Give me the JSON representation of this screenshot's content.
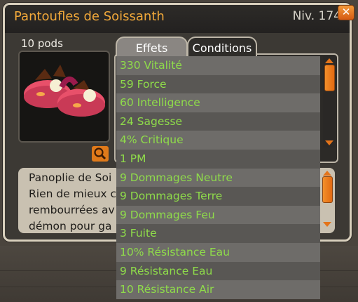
{
  "window": {
    "title": "Pantoufles de Soissanth",
    "level": "Niv. 174",
    "close_icon": "close-icon"
  },
  "item": {
    "weight": "10 pods",
    "image_icon": "pink-slippers-icon",
    "zoom_icon": "magnifier-icon"
  },
  "tabs": [
    {
      "label": "Effets",
      "active": true
    },
    {
      "label": "Conditions",
      "active": false
    }
  ],
  "effects": [
    "330 Vitalité",
    "59 Force",
    "60 Intelligence",
    "24 Sagesse",
    "4% Critique",
    "1 PM",
    "9 Dommages Neutre",
    "9 Dommages Terre",
    "9 Dommages Feu",
    "3 Fuite",
    "10% Résistance Eau",
    "9 Résistance Eau",
    "10 Résistance Air"
  ],
  "description": {
    "lines": [
      "Panoplie de Soi",
      "Rien de mieux c",
      "rembourrées av",
      "démon pour ga"
    ]
  },
  "colors": {
    "title": "#f2a93a",
    "effect_text": "#8fdc4a",
    "accent": "#e4741a"
  }
}
